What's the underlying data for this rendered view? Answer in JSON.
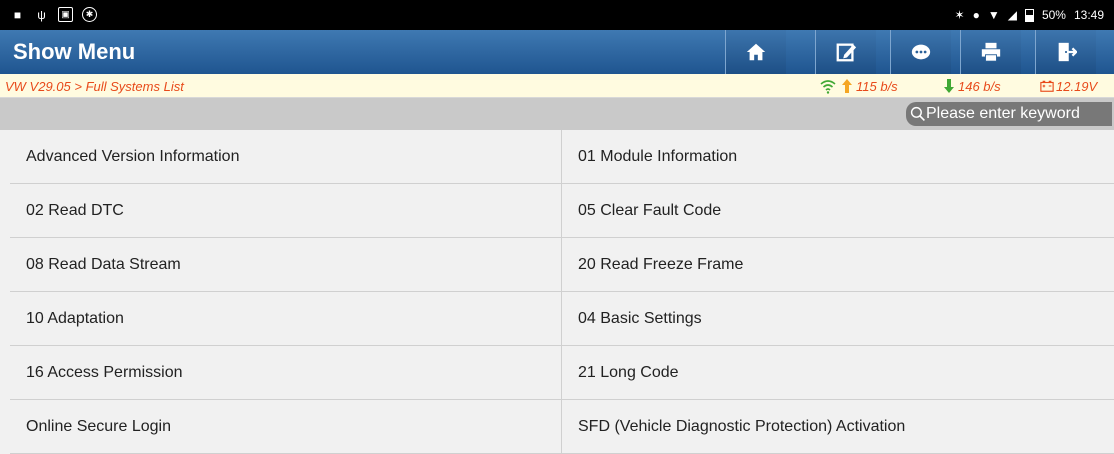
{
  "status_bar": {
    "left_icons": [
      "notification-icon",
      "usb-icon",
      "gallery-icon",
      "settings-circle-icon"
    ],
    "battery": "50%",
    "time": "13:49"
  },
  "header": {
    "title": "Show Menu",
    "buttons": [
      "home-icon",
      "edit-icon",
      "message-icon",
      "print-icon",
      "exit-icon"
    ],
    "accent": "#2a6199"
  },
  "info_bar": {
    "breadcrumb": "VW V29.05 > Full Systems List",
    "upload_rate": "115 b/s",
    "download_rate": "146 b/s",
    "voltage": "12.19V",
    "text_color": "#e84a1a"
  },
  "search": {
    "placeholder": "Please enter keyword"
  },
  "menu": [
    {
      "left": "Advanced Version Information",
      "right": "01 Module Information"
    },
    {
      "left": "02 Read DTC",
      "right": "05 Clear Fault Code"
    },
    {
      "left": "08 Read Data Stream",
      "right": "20 Read Freeze Frame"
    },
    {
      "left": "10 Adaptation",
      "right": "04 Basic Settings"
    },
    {
      "left": "16 Access Permission",
      "right": "21 Long Code"
    },
    {
      "left": "Online Secure Login",
      "right": "SFD (Vehicle Diagnostic Protection) Activation"
    }
  ]
}
